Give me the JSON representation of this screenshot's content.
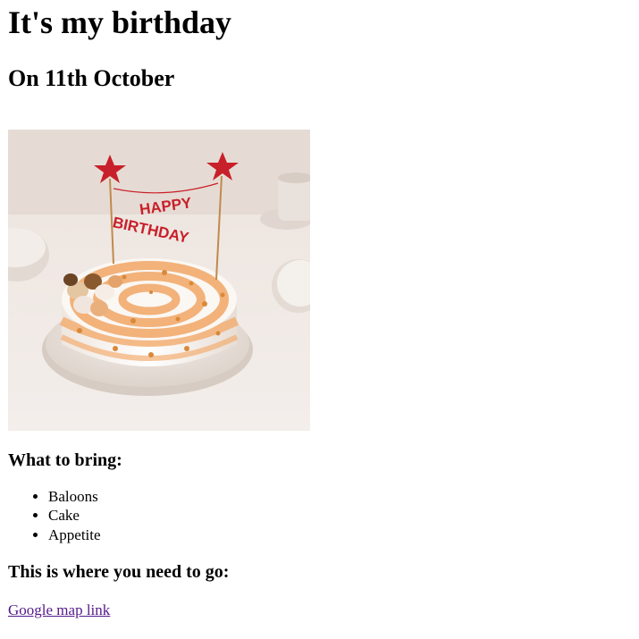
{
  "heading": "It's my birthday",
  "date": "On 11th October",
  "image": {
    "topper_text_line1": "HAPPY",
    "topper_text_line2": "BIRTHDAY"
  },
  "bring": {
    "title": "What to bring:",
    "items": [
      "Baloons",
      "Cake",
      "Appetite"
    ]
  },
  "directions": {
    "title": "This is where you need to go:",
    "link_text": "Google map link"
  },
  "colors": {
    "link_visited": "#551a8b",
    "topper_red": "#c8202a",
    "frosting_orange": "#f2b27a"
  }
}
